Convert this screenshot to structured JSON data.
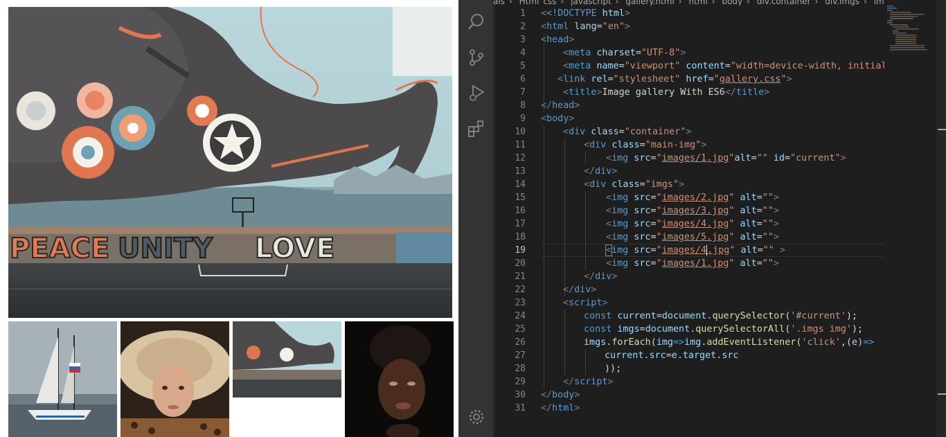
{
  "breadcrumb": [
    "als",
    "Html_css",
    "javascript",
    "gallery.html",
    "html",
    "body",
    "div.container",
    "div.imgs",
    "img"
  ],
  "editor": {
    "line_numbers": [
      "1",
      "2",
      "3",
      "4",
      "5",
      "6",
      "7",
      "8",
      "9",
      "10",
      "11",
      "12",
      "13",
      "14",
      "15",
      "16",
      "17",
      "18",
      "19",
      "20",
      "21",
      "22",
      "23",
      "24",
      "25",
      "26",
      "27",
      "28",
      "29",
      "30",
      "31"
    ],
    "active_line": "19"
  },
  "activity_icons": [
    "search-icon",
    "source-control-icon",
    "run-debug-icon",
    "extensions-icon",
    "settings-gear-icon"
  ],
  "preview": {
    "main_image": "graffiti-elephant-mural",
    "thumbnails": [
      "sailboat-photo",
      "woman-straw-hat-photo",
      "graffiti-elephant-mural-thumbnail",
      "woman-dark-portrait-photo"
    ]
  },
  "colors": {
    "editor_bg": "#1e1e1e",
    "activity_bar": "#333333",
    "tag": "#569cd6",
    "attribute": "#9cdcfe",
    "string": "#ce9178",
    "function": "#dcdcaa",
    "punctuation": "#808080"
  },
  "code": {
    "l1": {
      "a": "<!DOCTYPE",
      "b": " html",
      ">": ">"
    },
    "l2": {
      "o": "<",
      "tag": "html",
      "attr": " lang",
      "eq": "=",
      "val": "\"en\"",
      "c": ">"
    },
    "l3": {
      "o": "<",
      "tag": "head",
      "c": ">"
    },
    "l4": {
      "o": "<",
      "tag": "meta",
      "attr": " charset",
      "eq": "=",
      "val": "\"UTF-8\"",
      "c": ">"
    },
    "l5": {
      "o": "<",
      "tag": "meta",
      "attr": " name",
      "eq": "=",
      "val": "\"viewport\"",
      "attr2": " content",
      "eq2": "=",
      "val2": "\"width=device-width, initial-sc"
    },
    "l6": {
      "o": "<",
      "tag": "link",
      "attr": " rel",
      "eq": "=",
      "val": "\"stylesheet\"",
      "attr2": " href",
      "eq2": "=",
      "q1": "\"",
      "val2": "gallery.css",
      "q2": "\"",
      "c": ">"
    },
    "l7": {
      "o": "<",
      "tag": "title",
      "c": ">",
      "text": "Image gallery With ES6",
      "o2": "</",
      "tag2": "title",
      "c2": ">"
    },
    "l8": {
      "o": "</",
      "tag": "head",
      "c": ">"
    },
    "l9": {
      "o": "<",
      "tag": "body",
      "c": ">"
    },
    "l10": {
      "o": "<",
      "tag": "div",
      "attr": " class",
      "eq": "=",
      "val": "\"container\"",
      "c": ">"
    },
    "l11": {
      "o": "<",
      "tag": "div",
      "attr": " class",
      "eq": "=",
      "val": "\"main-img\"",
      "c": ">"
    },
    "l12": {
      "o": "<",
      "tag": "img",
      "attr": " src",
      "eq": "=",
      "q1": "\"",
      "val": "images/1.jpg",
      "q2": "\"",
      "attr2": "alt",
      "eq2": "=",
      "val2": "\"\"",
      "attr3": " id",
      "eq3": "=",
      "val3": "\"current\"",
      "c": ">"
    },
    "l13": {
      "o": "</",
      "tag": "div",
      "c": ">"
    },
    "l14": {
      "o": "<",
      "tag": "div",
      "attr": " class",
      "eq": "=",
      "val": "\"imgs\"",
      "c": ">"
    },
    "l15": {
      "o": "<",
      "tag": "img",
      "attr": " src",
      "eq": "=",
      "q1": "\"",
      "val": "images/2.jpg",
      "q2": "\"",
      "attr2": " alt",
      "eq2": "=",
      "val2": "\"\"",
      "c": ">"
    },
    "l16": {
      "o": "<",
      "tag": "img",
      "attr": " src",
      "eq": "=",
      "q1": "\"",
      "val": "images/3.jpg",
      "q2": "\"",
      "attr2": " alt",
      "eq2": "=",
      "val2": "\"\"",
      "c": ">"
    },
    "l17": {
      "o": "<",
      "tag": "img",
      "attr": " src",
      "eq": "=",
      "q1": "\"",
      "val": "images/4.jpg",
      "q2": "\"",
      "attr2": " alt",
      "eq2": "=",
      "val2": "\"\"",
      "c": ">"
    },
    "l18": {
      "o": "<",
      "tag": "img",
      "attr": " src",
      "eq": "=",
      "q1": "\"",
      "val": "images/5.jpg",
      "q2": "\"",
      "attr2": " alt",
      "eq2": "=",
      "val2": "\"\"",
      "c": ">"
    },
    "l19": {
      "o": "<",
      "tag": "img",
      "attr": " src",
      "eq": "=",
      "q1": "\"",
      "val_a": "images/4",
      "val_b": ".jpg",
      "q2": "\"",
      "attr2": " alt",
      "eq2": "=",
      "val2": "\"\"",
      "c": " >"
    },
    "l20": {
      "o": "<",
      "tag": "img",
      "attr": " src",
      "eq": "=",
      "q1": "\"",
      "val": "images/1.jpg",
      "q2": "\"",
      "attr2": " alt",
      "eq2": "=",
      "val2": "\"\"",
      "c": ">"
    },
    "l21": {
      "o": "</",
      "tag": "div",
      "c": ">"
    },
    "l22": {
      "o": "</",
      "tag": "div",
      "c": ">"
    },
    "l23": {
      "o": "<",
      "tag": "script",
      "c": ">"
    },
    "l24": {
      "kw": "const",
      "sp": " ",
      "v1": "current",
      "eq": "=",
      "v2": "document",
      "dot": ".",
      "fn": "querySelector",
      "p1": "(",
      "str": "'#current'",
      "p2": ");"
    },
    "l25": {
      "kw": "const",
      "sp": " ",
      "v1": "imgs",
      "eq": "=",
      "v2": "document",
      "dot": ".",
      "fn": "querySelectorAll",
      "p1": "(",
      "str": "'.imgs img'",
      "p2": ");"
    },
    "l26": {
      "v1": "imgs",
      "dot": ".",
      "fn": "forEach",
      "p1": "(",
      "v2": "img",
      "arrow": "=>",
      "v3": "img",
      "dot2": ".",
      "fn2": "addEventListener",
      "p2": "(",
      "str": "'click'",
      "comma": ",",
      "p3": "(",
      "v4": "e",
      "p4": ")",
      "arrow2": "=>"
    },
    "l27": {
      "v1": "current",
      "dot": ".",
      "v2": "src",
      "eq": "=",
      "v3": "e",
      "dot2": ".",
      "v4": "target",
      "dot3": ".",
      "v5": "src"
    },
    "l28": {
      "text": "));"
    },
    "l29": {
      "o": "</",
      "tag": "script",
      "c": ">"
    },
    "l30": {
      "o": "</",
      "tag": "body",
      "c": ">"
    },
    "l31": {
      "o": "</",
      "tag": "html",
      "c": ">"
    }
  }
}
